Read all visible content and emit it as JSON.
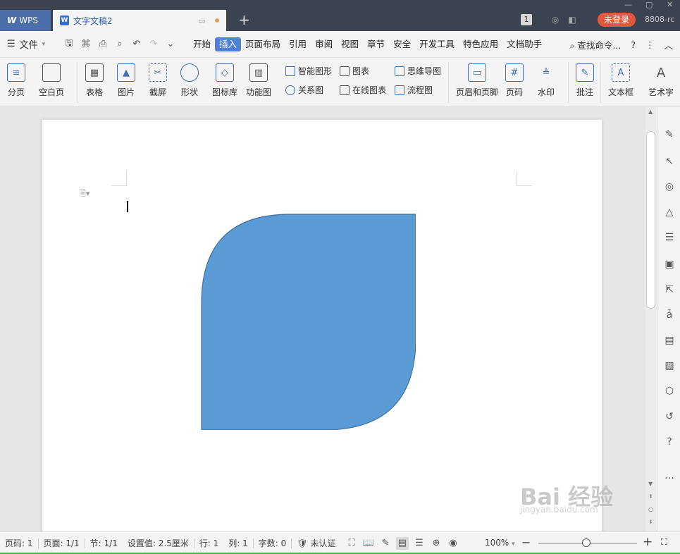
{
  "titlebar": {
    "app_tab": "WPS",
    "doc_tab": "文字文稿2",
    "badge": "1",
    "login": "未登录",
    "user_id": "8808-rc"
  },
  "menu": {
    "file": "文件",
    "items": [
      "开始",
      "插入",
      "页面布局",
      "引用",
      "审阅",
      "视图",
      "章节",
      "安全",
      "开发工具",
      "特色应用",
      "文档助手"
    ],
    "active": "插入",
    "search": "查找命令...",
    "help": "?"
  },
  "ribbon": {
    "page_break": "分页",
    "blank_page": "空白页",
    "table": "表格",
    "picture": "图片",
    "screenshot": "截屏",
    "shape": "形状",
    "icon_lib": "图标库",
    "func_chart": "功能图",
    "smart_art": "智能图形",
    "chart": "图表",
    "mindmap": "思维导图",
    "relation": "关系图",
    "online_chart": "在线图表",
    "flowchart": "流程图",
    "header_footer": "页眉和页脚",
    "page_number": "页码",
    "watermark": "水印",
    "comment": "批注",
    "textbox": "文本框",
    "wordart": "艺术字"
  },
  "shape": {
    "fill": "#5b9bd5",
    "stroke": "#41719c"
  },
  "status": {
    "page_num": "页码: 1",
    "pages": "页面: 1/1",
    "section": "节: 1/1",
    "setting": "设置值: 2.5厘米",
    "row": "行: 1",
    "col": "列: 1",
    "words": "字数: 0",
    "auth": "未认证",
    "zoom": "100%"
  },
  "watermark": {
    "text": "Bai  经验",
    "sub": "jingyan.baidu.com"
  }
}
